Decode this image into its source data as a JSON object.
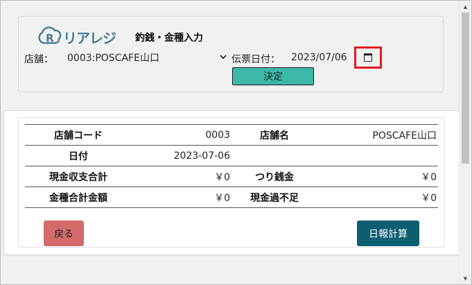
{
  "header": {
    "brand": "リアレジ",
    "title": "釣銭・金種入力",
    "store_label": "店舗：",
    "store_value": "0003:POSCAFE山口",
    "date_label": "伝票日付：",
    "date_value": "2023/07/06",
    "decide_label": "決定"
  },
  "summary": {
    "rows": [
      {
        "label1": "店舗コード",
        "value1": "0003",
        "label2": "店舗名",
        "value2": "POSCAFE山口"
      },
      {
        "label1": "日付",
        "value1": "2023-07-06",
        "label2": "",
        "value2": ""
      },
      {
        "label1": "現金収支合計",
        "value1": "￥0",
        "label2": "つり銭金",
        "value2": "￥0"
      },
      {
        "label1": "金種合計金額",
        "value1": "￥0",
        "label2": "現金過不足",
        "value2": "￥0"
      }
    ]
  },
  "buttons": {
    "back_label": "戻る",
    "report_label": "日報計算"
  },
  "icons": {
    "logo": "rearegi-logo-icon",
    "calendar": "calendar-icon",
    "chevron": "chevron-down-icon"
  },
  "colors": {
    "brand": "#4a7a94",
    "decide_button": "#3cb8a8",
    "back_button": "#d46a6a",
    "report_button": "#0e5e72",
    "highlight_box": "#e01c1c"
  }
}
